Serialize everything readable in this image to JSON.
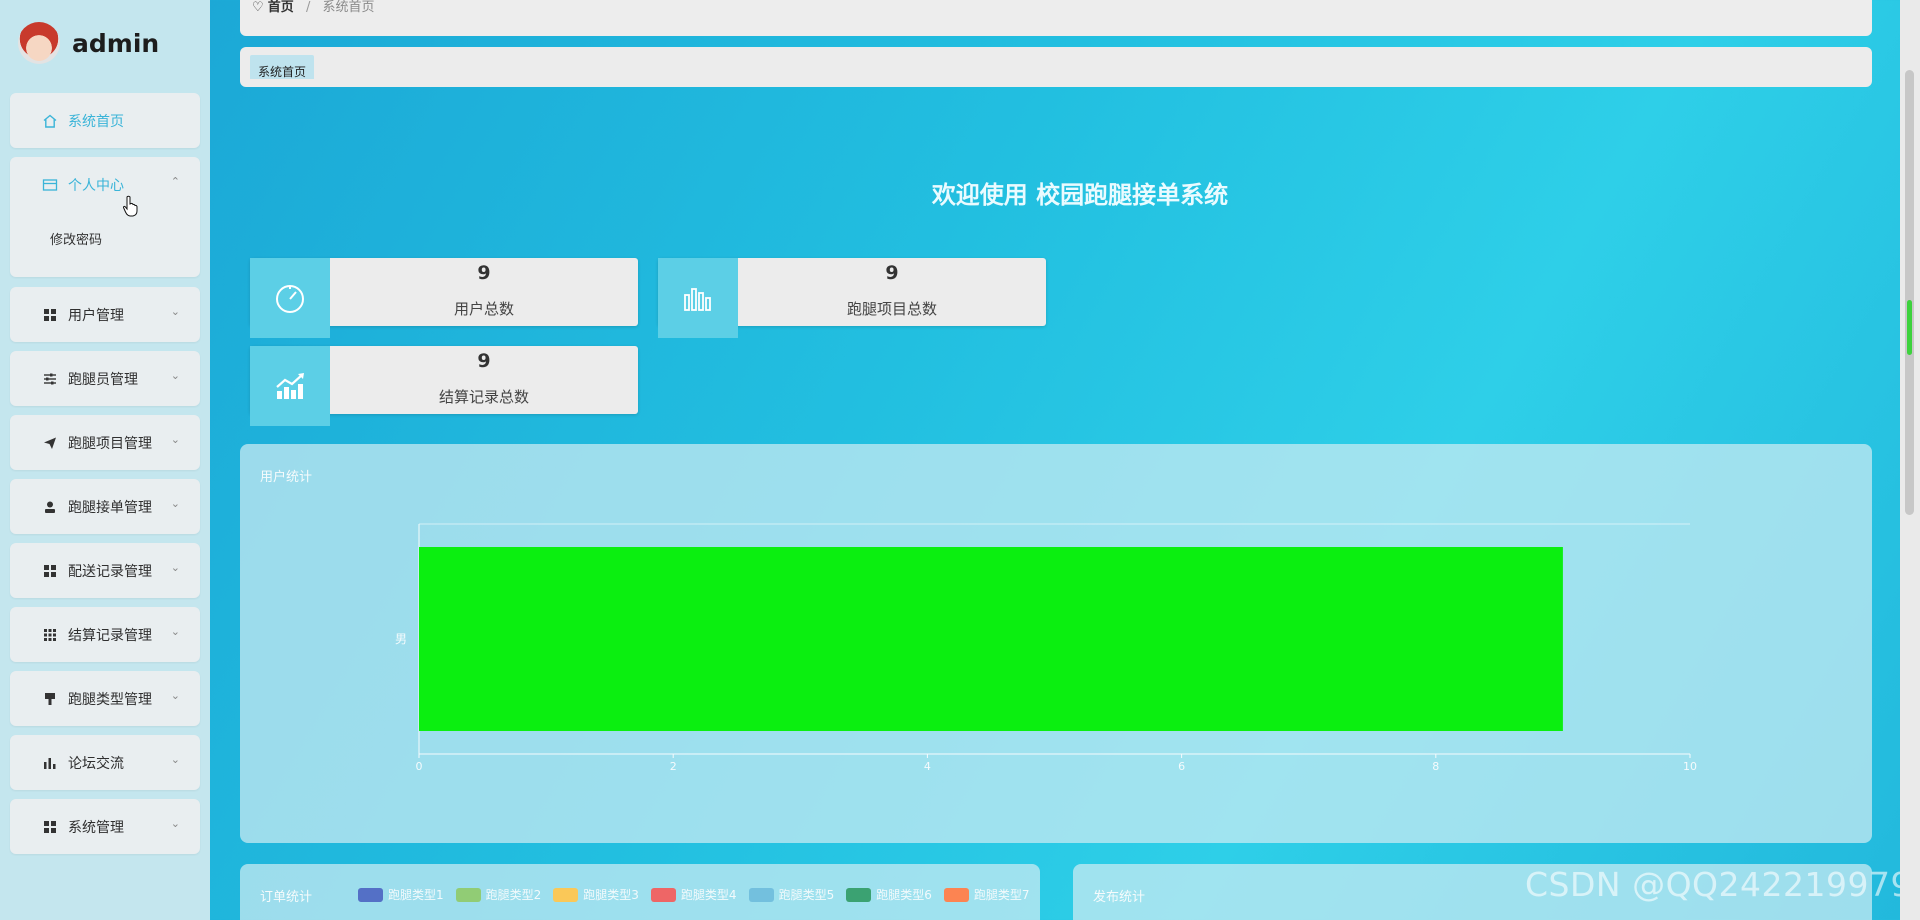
{
  "sidebar": {
    "brand": "admin",
    "menu": [
      {
        "label": "系统首页",
        "icon": "home-icon"
      },
      {
        "label": "个人中心",
        "icon": "card-icon",
        "sub": [
          "修改密码"
        ]
      },
      {
        "label": "用户管理",
        "icon": "grid-icon"
      },
      {
        "label": "跑腿员管理",
        "icon": "sliders-icon"
      },
      {
        "label": "跑腿项目管理",
        "icon": "send-icon"
      },
      {
        "label": "跑腿接单管理",
        "icon": "person-icon"
      },
      {
        "label": "配送记录管理",
        "icon": "grid-icon"
      },
      {
        "label": "结算记录管理",
        "icon": "apps-icon"
      },
      {
        "label": "跑腿类型管理",
        "icon": "brush-icon"
      },
      {
        "label": "论坛交流",
        "icon": "bar-chart-icon"
      },
      {
        "label": "系统管理",
        "icon": "grid-icon"
      }
    ]
  },
  "breadcrumb": {
    "home": "首页",
    "separator": "/",
    "current": "系统首页"
  },
  "tabs": [
    "系统首页"
  ],
  "welcome": "欢迎使用 校园跑腿接单系统",
  "stats": [
    {
      "value": "9",
      "label": "用户总数",
      "icon": "timer-icon"
    },
    {
      "value": "9",
      "label": "跑腿项目总数",
      "icon": "bar-chart-icon"
    },
    {
      "value": "9",
      "label": "结算记录总数",
      "icon": "trend-chart-icon"
    }
  ],
  "panels": {
    "user_stats_title": "用户统计",
    "order_stats_title": "订单统计",
    "publish_stats_title": "发布统计"
  },
  "chart_data": {
    "type": "bar",
    "orientation": "horizontal",
    "title": "用户统计",
    "categories": [
      "男"
    ],
    "values": [
      9
    ],
    "xlim": [
      0,
      10
    ],
    "xticks": [
      "0",
      "2",
      "4",
      "6",
      "8",
      "10"
    ],
    "bar_color": "#0bef10"
  },
  "order_legend": [
    {
      "label": "跑腿类型1",
      "color": "#5470c6"
    },
    {
      "label": "跑腿类型2",
      "color": "#91cc75"
    },
    {
      "label": "跑腿类型3",
      "color": "#fac858"
    },
    {
      "label": "跑腿类型4",
      "color": "#ee6666"
    },
    {
      "label": "跑腿类型5",
      "color": "#73c0de"
    },
    {
      "label": "跑腿类型6",
      "color": "#3ba272"
    },
    {
      "label": "跑腿类型7",
      "color": "#fc8452"
    }
  ],
  "watermark": "CSDN @QQ242219979"
}
